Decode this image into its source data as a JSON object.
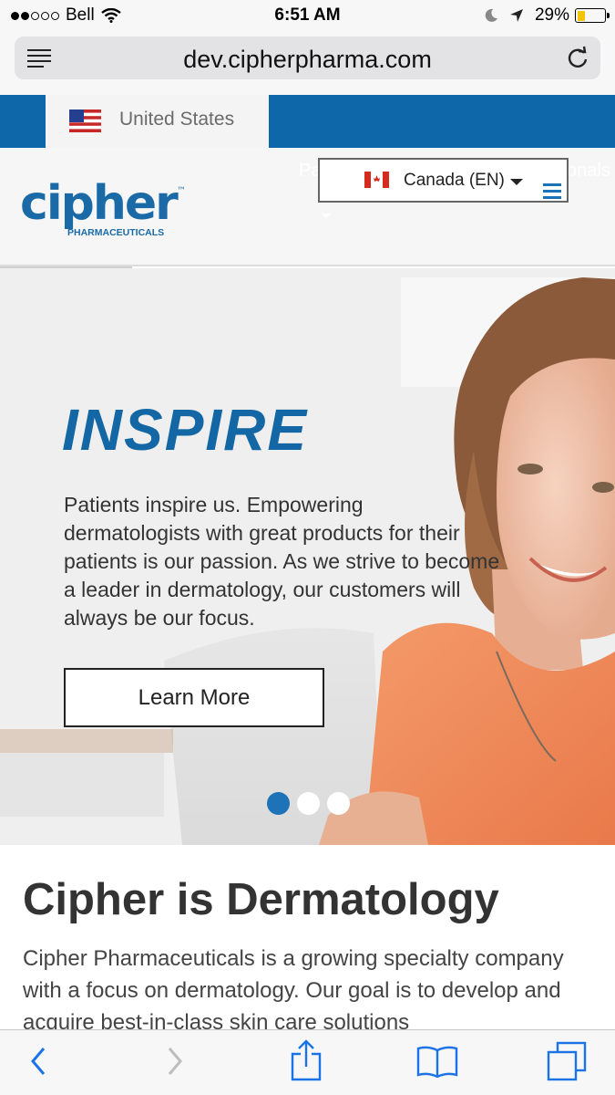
{
  "status": {
    "carrier": "Bell",
    "time": "6:51 AM",
    "battery": "29%",
    "battery_level": 0.29
  },
  "browser": {
    "url": "dev.cipherpharma.com"
  },
  "country_selector": {
    "label": "United States"
  },
  "header": {
    "logo_text": "cipher",
    "logo_subtext": "PHARMACEUTICALS",
    "trademark": "™",
    "nav_fragment_left": "Pa",
    "nav_fragment_right": "onals",
    "language": "Canada (EN)"
  },
  "hero": {
    "title": "INSPIRE",
    "body": "Patients inspire us. Empowering dermatologists with great products for their patients is our passion. As we strive to become a leader in dermatology, our customers will always be our focus.",
    "cta": "Learn More",
    "slides": 3,
    "active_slide": 1
  },
  "section": {
    "title": "Cipher is Dermatology",
    "body": "Cipher Pharmaceuticals is a growing specialty company with a focus on dermatology. Our goal is to develop and acquire best-in-class skin care solutions"
  },
  "icons": {
    "reader": "reader-icon",
    "reload": "reload-icon",
    "back": "back-icon",
    "forward": "forward-icon",
    "share": "share-icon",
    "bookmarks": "bookmarks-icon",
    "tabs": "tabs-icon",
    "menu": "menu-icon"
  },
  "colors": {
    "brand_blue": "#0d67a8",
    "hero_title": "#1267a4",
    "active_dot": "#1d72b8",
    "shirt": "#f08a5a"
  }
}
